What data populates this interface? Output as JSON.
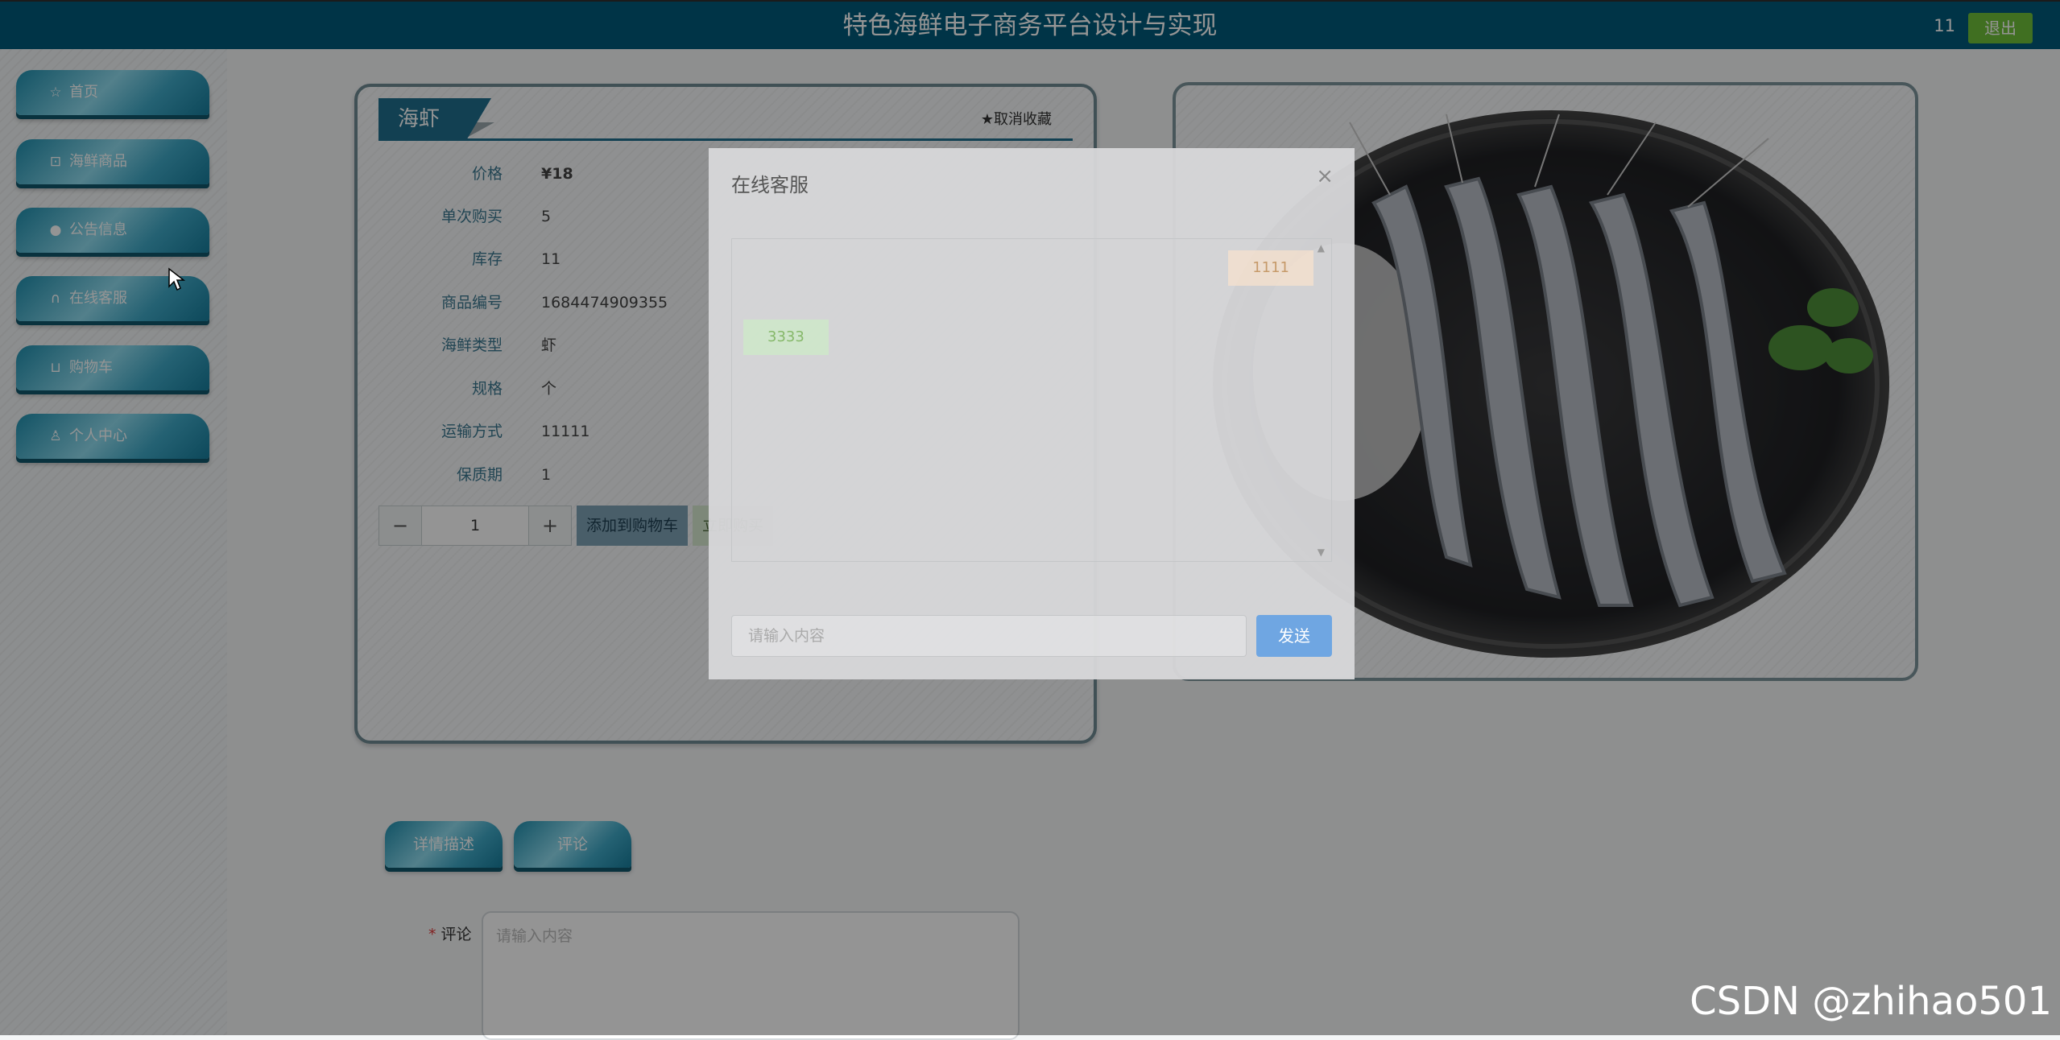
{
  "header": {
    "title": "特色海鲜电子商务平台设计与实现",
    "username": "11",
    "logout_label": "退出"
  },
  "sidebar": {
    "items": [
      {
        "icon": "star-icon",
        "label": "首页"
      },
      {
        "icon": "bag-icon",
        "label": "海鲜商品"
      },
      {
        "icon": "info-icon",
        "label": "公告信息"
      },
      {
        "icon": "headset-icon",
        "label": "在线客服"
      },
      {
        "icon": "cart-icon",
        "label": "购物车"
      },
      {
        "icon": "user-icon",
        "label": "个人中心"
      }
    ]
  },
  "product": {
    "name": "海虾",
    "favorite_label": "取消收藏",
    "attributes": [
      {
        "key": "价格",
        "value": "¥18"
      },
      {
        "key": "单次购买",
        "value": "5"
      },
      {
        "key": "库存",
        "value": "11"
      },
      {
        "key": "商品编号",
        "value": "1684474909355"
      },
      {
        "key": "海鲜类型",
        "value": "虾"
      },
      {
        "key": "规格",
        "value": "个"
      },
      {
        "key": "运输方式",
        "value": "11111"
      },
      {
        "key": "保质期",
        "value": "1"
      }
    ],
    "quantity": "1",
    "minus_symbol": "−",
    "plus_symbol": "+",
    "add_to_cart_label": "添加到购物车",
    "buy_now_label": "立即购买"
  },
  "tabs": {
    "detail_label": "详情描述",
    "comment_label": "评论"
  },
  "comment": {
    "label": "评论",
    "placeholder": "请输入内容"
  },
  "chat_dialog": {
    "title": "在线客服",
    "messages": [
      {
        "from": "me",
        "text": "1111"
      },
      {
        "from": "service",
        "text": "3333"
      }
    ],
    "input_placeholder": "请输入内容",
    "send_label": "发送"
  },
  "watermark": "CSDN @zhihao501",
  "colors": {
    "header_bg": "#005b7a",
    "accent": "#1f6f8e",
    "logout_bg": "#6fbf3a",
    "send_bg": "#6fa6e2"
  }
}
